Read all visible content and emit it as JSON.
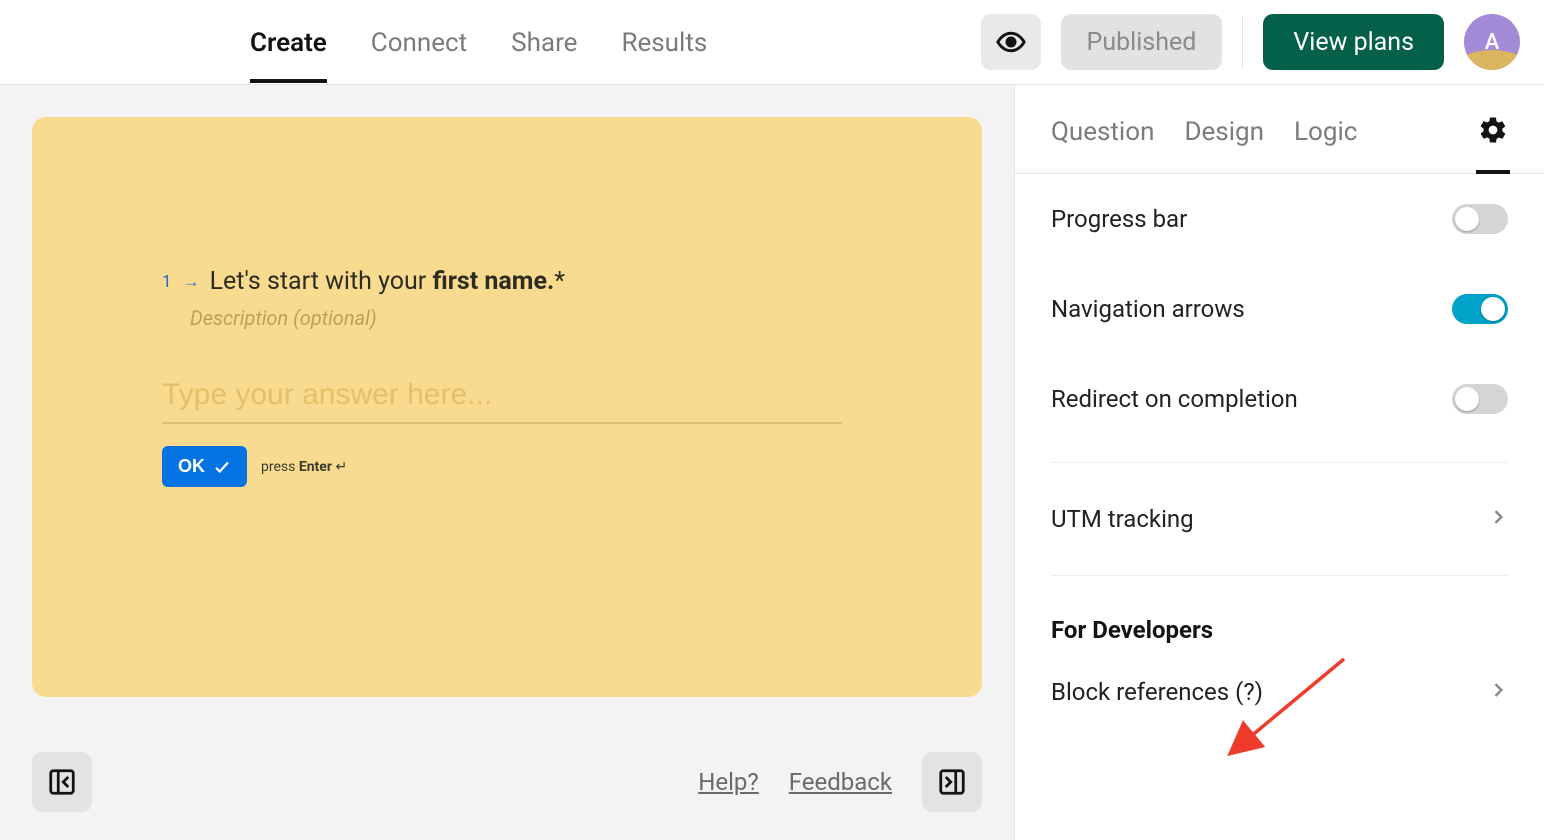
{
  "header": {
    "tabs": [
      "Create",
      "Connect",
      "Share",
      "Results"
    ],
    "active_tab_index": 0,
    "published_label": "Published",
    "view_plans_label": "View plans",
    "avatar_initial": "A"
  },
  "canvas": {
    "question_number": "1",
    "question_text_prefix": "Let's start with your ",
    "question_text_bold": "first name.",
    "question_required_mark": "*",
    "description_placeholder": "Description (optional)",
    "answer_placeholder": "Type your answer here...",
    "ok_label": "OK",
    "hint_prefix": "press ",
    "hint_key": "Enter",
    "hint_glyph": "↵",
    "help_label": "Help?",
    "feedback_label": "Feedback"
  },
  "sidepanel": {
    "tabs": [
      "Question",
      "Design",
      "Logic"
    ],
    "active_is_gear": true,
    "rows": {
      "progress_bar": {
        "label": "Progress bar",
        "on": false
      },
      "nav_arrows": {
        "label": "Navigation arrows",
        "on": true
      },
      "redirect": {
        "label": "Redirect on completion",
        "on": false
      },
      "utm": {
        "label": "UTM tracking"
      },
      "dev_header": "For Developers",
      "block_refs": {
        "label": "Block references (?)"
      }
    }
  }
}
